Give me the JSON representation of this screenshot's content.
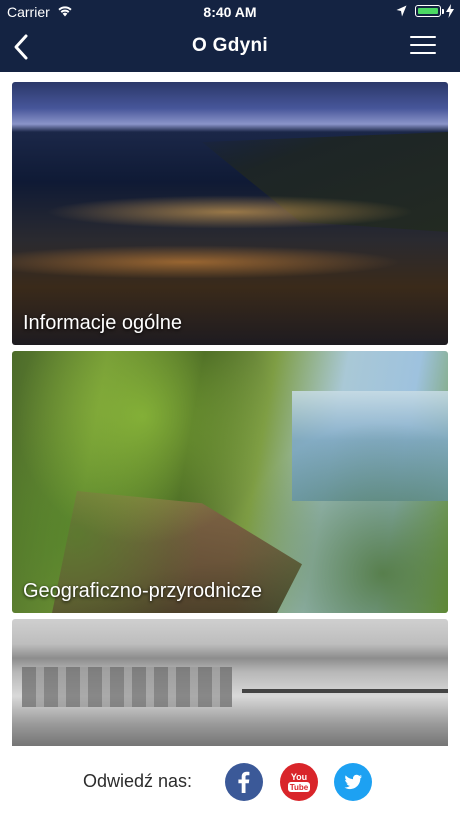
{
  "status_bar": {
    "carrier": "Carrier",
    "time": "8:40 AM",
    "icons": [
      "wifi-icon",
      "location-arrow-icon",
      "battery-icon",
      "charging-bolt-icon"
    ]
  },
  "nav": {
    "title": "O Gdyni",
    "back_icon": "chevron-left-icon",
    "menu_icon": "hamburger-menu-icon"
  },
  "cards": [
    {
      "label": "Informacje ogólne",
      "image": "gdynia-city-night-panorama"
    },
    {
      "label": "Geograficzno-przyrodnicze",
      "image": "forest-cliff-sea-view"
    },
    {
      "label": "",
      "image": "historic-gdynia-beach-photo"
    }
  ],
  "footer": {
    "visit_label": "Odwiedź nas:",
    "social": [
      {
        "name": "facebook",
        "icon": "facebook-icon",
        "color": "#3b5998"
      },
      {
        "name": "youtube",
        "icon": "youtube-icon",
        "text": "You Tube",
        "color": "#d9252a"
      },
      {
        "name": "twitter",
        "icon": "twitter-icon",
        "color": "#1da1f2"
      }
    ]
  },
  "colors": {
    "header_bg": "#142342",
    "battery_fill": "#4cd964"
  }
}
